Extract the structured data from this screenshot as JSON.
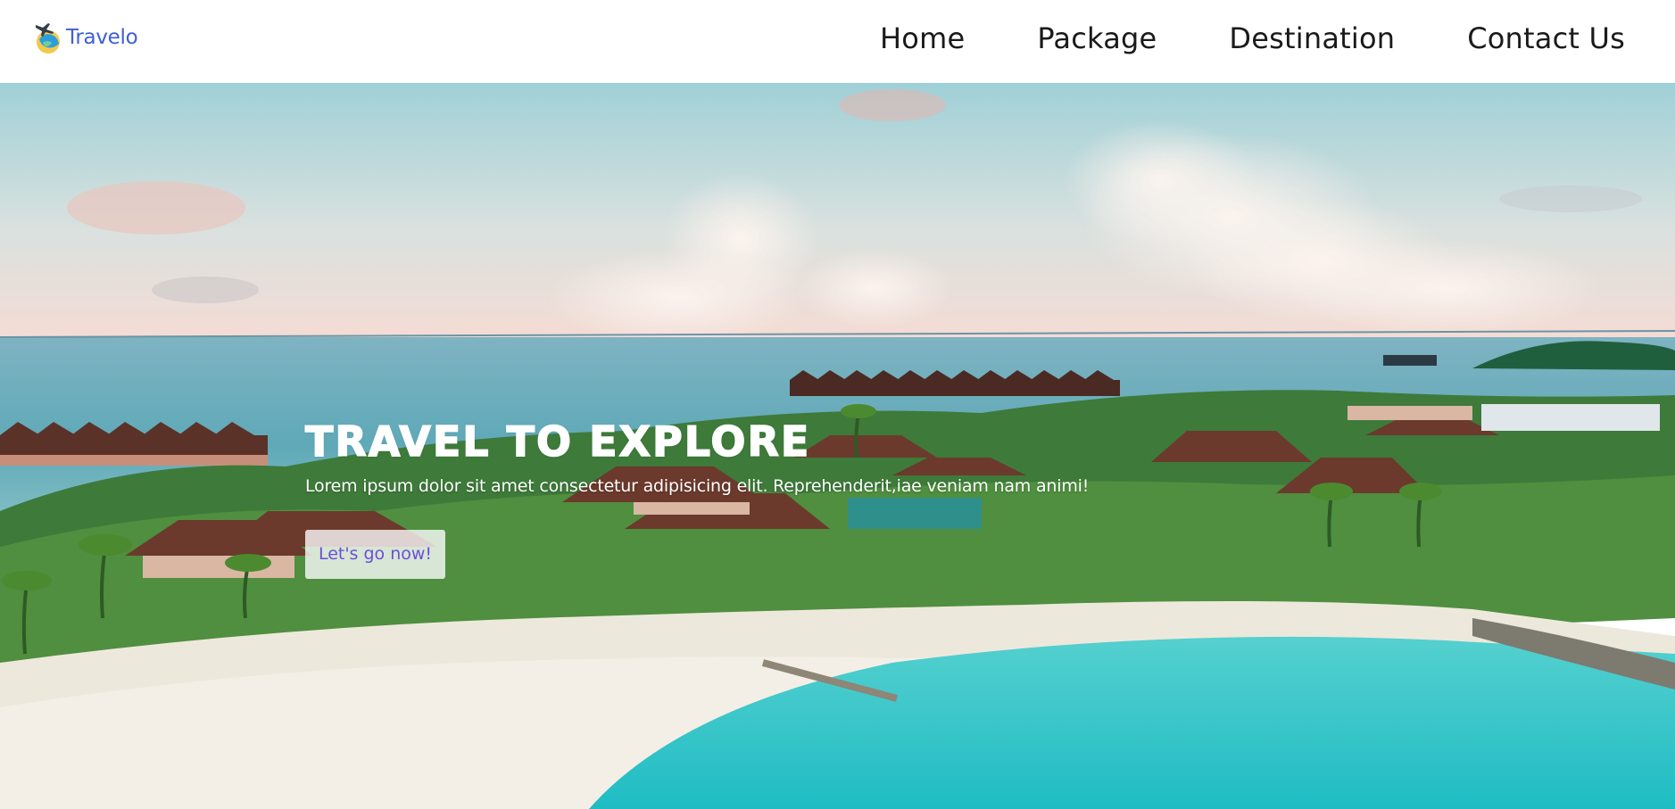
{
  "brand": {
    "name": "Travelo",
    "logo_icon": "globe-plane-icon"
  },
  "nav": {
    "items": [
      {
        "label": "Home"
      },
      {
        "label": "Package"
      },
      {
        "label": "Destination"
      },
      {
        "label": "Contact Us"
      }
    ]
  },
  "hero": {
    "title": "TRAVEL TO EXPLORE",
    "subtitle": "Lorem ipsum dolor sit amet consectetur adipisicing elit. Reprehenderit,iae veniam nam animi!",
    "cta_label": "Let's go now!",
    "background": "tropical-island-resort-photo"
  },
  "colors": {
    "brand": "#3f5fd4",
    "nav_text": "#1a1a1a",
    "cta_text": "#6a4fd8",
    "lagoon": "#2fc4c8",
    "sky_top": "#9ecfd6",
    "sky_horizon": "#f6dcd3"
  }
}
